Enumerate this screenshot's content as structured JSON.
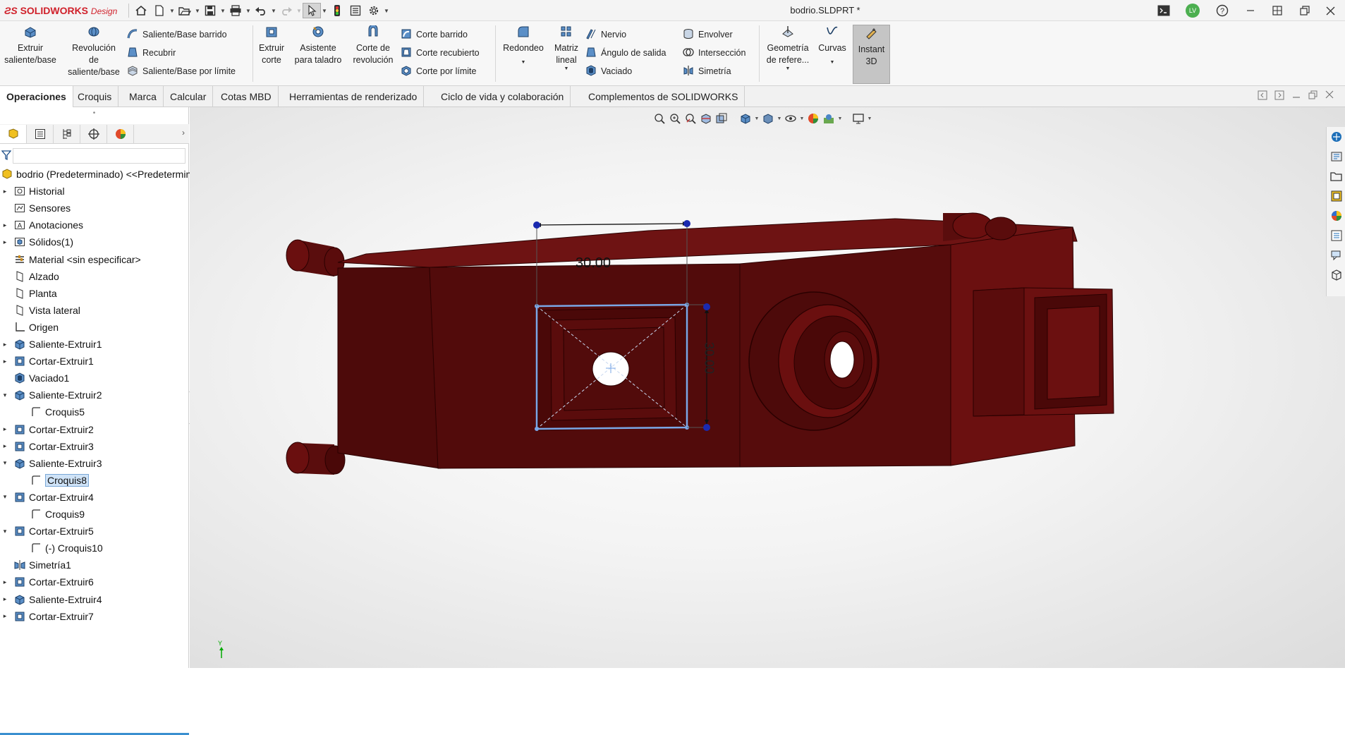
{
  "app": {
    "brand_bold": "SOLIDWORKS",
    "brand_light": "Design",
    "document_title": "bodrio.SLDPRT *",
    "user_initials": "LV"
  },
  "quick_access": [
    {
      "name": "home-icon"
    },
    {
      "name": "new-file-icon"
    },
    {
      "name": "open-file-icon"
    },
    {
      "name": "save-icon"
    },
    {
      "name": "print-icon"
    },
    {
      "name": "undo-icon"
    },
    {
      "name": "redo-icon"
    },
    {
      "name": "select-icon"
    },
    {
      "name": "rebuild-icon"
    },
    {
      "name": "file-properties-icon"
    },
    {
      "name": "options-icon"
    }
  ],
  "ribbon": {
    "extrude_boss": "Extruir saliente/base",
    "revolve_boss_l1": "Revolución",
    "revolve_boss_l2": "de",
    "revolve_boss_l3": "saliente/base",
    "swept_boss": "Saliente/Base barrido",
    "loft": "Recubrir",
    "boundary_boss": "Saliente/Base por límite",
    "extrude_cut_l1": "Extruir",
    "extrude_cut_l2": "corte",
    "hole_wizard_l1": "Asistente",
    "hole_wizard_l2": "para taladro",
    "revolve_cut_l1": "Corte de",
    "revolve_cut_l2": "revolución",
    "swept_cut": "Corte barrido",
    "lofted_cut": "Corte recubierto",
    "boundary_cut": "Corte por límite",
    "fillet": "Redondeo",
    "pattern_l1": "Matriz",
    "pattern_l2": "lineal",
    "rib": "Nervio",
    "draft": "Ángulo de salida",
    "shell": "Vaciado",
    "wrap": "Envolver",
    "intersect": "Intersección",
    "mirror": "Simetría",
    "ref_geometry_l1": "Geometría",
    "ref_geometry_l2": "de refere...",
    "curves": "Curvas",
    "instant3d_l1": "Instant",
    "instant3d_l2": "3D"
  },
  "tabs": [
    "Operaciones",
    "Croquis",
    "Marca",
    "Calcular",
    "Cotas MBD",
    "Herramientas de renderizado",
    "Ciclo de vida y colaboración",
    "Complementos de SOLIDWORKS"
  ],
  "tree": {
    "root": "bodrio (Predeterminado) <<Predeterminado>",
    "items": [
      "Historial",
      "Sensores",
      "Anotaciones",
      "Sólidos(1)",
      "Material <sin especificar>",
      "Alzado",
      "Planta",
      "Vista lateral",
      "Origen",
      "Saliente-Extruir1",
      "Cortar-Extruir1",
      "Vaciado1",
      "Saliente-Extruir2",
      "Croquis5",
      "Cortar-Extruir2",
      "Cortar-Extruir3",
      "Saliente-Extruir3",
      "Croquis8",
      "Cortar-Extruir4",
      "Croquis9",
      "Cortar-Extruir5",
      "(-) Croquis10",
      "Simetría1",
      "Cortar-Extruir6",
      "Saliente-Extruir4",
      "Cortar-Extruir7"
    ]
  },
  "viewport": {
    "dim_horizontal": "30.00",
    "dim_vertical": "30.00",
    "triad_y": "Y"
  },
  "colors": {
    "model": "#6b1010",
    "model_dark": "#4d0a0a",
    "sketch": "#7aa7e6",
    "accent": "#3a8fd0"
  }
}
